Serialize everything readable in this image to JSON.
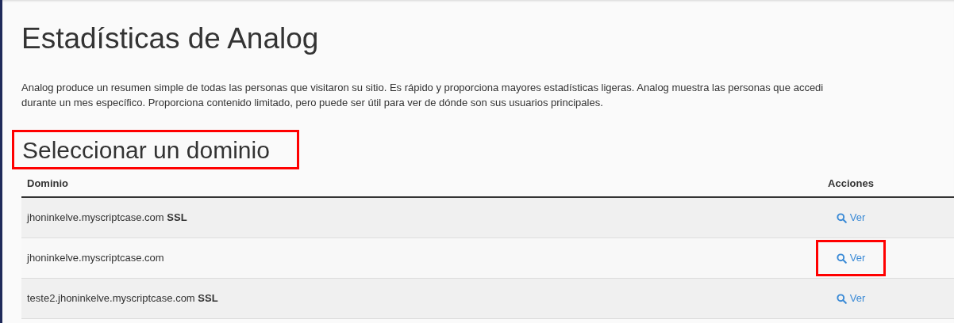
{
  "title": "Estadísticas de Analog",
  "description": [
    "Analog produce un resumen simple de todas las personas que visitaron su sitio. Es rápido y proporciona mayores estadísticas ligeras. Analog muestra las personas que accedi",
    "durante un mes específico. Proporciona contenido limitado, pero puede ser útil para ver de dónde son sus usuarios principales."
  ],
  "section": {
    "heading": "Seleccionar un dominio",
    "highlighted": true
  },
  "table": {
    "columns": [
      "Dominio",
      "Acciones"
    ],
    "rows": [
      {
        "domain": "jhoninkelve.myscriptcase.com **SSL**",
        "action": "Ver",
        "highlighted": false
      },
      {
        "domain": "jhoninkelve.myscriptcase.com",
        "action": "Ver",
        "highlighted": true
      },
      {
        "domain": "teste2.jhoninkelve.myscriptcase.com **SSL**",
        "action": "Ver",
        "highlighted": false
      }
    ]
  }
}
